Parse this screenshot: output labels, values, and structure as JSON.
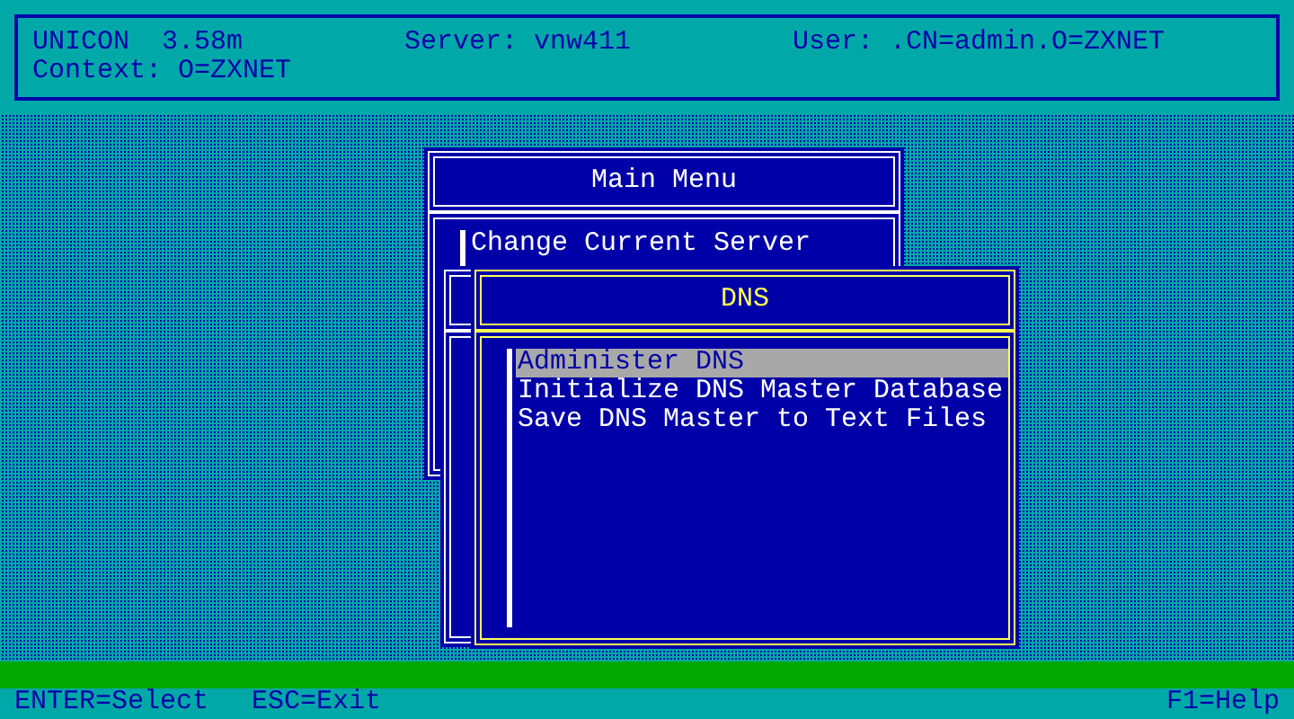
{
  "header": {
    "program": "UNICON",
    "version": "3.58m",
    "server": "Server: vnw411",
    "user": "User: .CN=admin.O=ZXNET",
    "context": "Context: O=ZXNET"
  },
  "main_menu": {
    "title": "Main Menu",
    "items": [
      {
        "label": "Change Current Server",
        "selected": false
      }
    ]
  },
  "dns_menu": {
    "title": "DNS",
    "items": [
      {
        "label": "Administer DNS",
        "selected": true
      },
      {
        "label": "Initialize DNS Master Database",
        "selected": false
      },
      {
        "label": "Save DNS Master to Text Files",
        "selected": false
      }
    ]
  },
  "status_bar": {
    "left": [
      "ENTER=Select",
      "ESC=Exit"
    ],
    "right": "F1=Help"
  }
}
